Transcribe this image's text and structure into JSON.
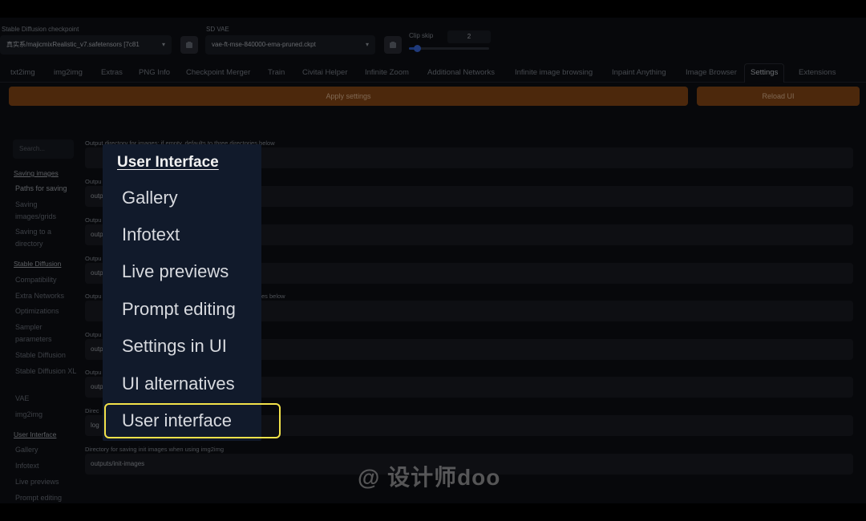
{
  "topbar": {
    "checkpoint_label": "Stable Diffusion checkpoint",
    "checkpoint_value": "真实系/majicmixRealistic_v7.safetensors [7c81",
    "vae_label": "SD VAE",
    "vae_value": "vae-ft-mse-840000-ema-pruned.ckpt",
    "clip_label": "Clip skip",
    "clip_value": "2",
    "clip_skip_level": 0.1
  },
  "tabs": [
    "txt2img",
    "img2img",
    "Extras",
    "PNG Info",
    "Checkpoint Merger",
    "Train",
    "Civitai Helper",
    "Infinite Zoom",
    "Additional Networks",
    "Infinite image browsing",
    "Inpaint Anything",
    "Image Browser",
    "Settings",
    "Extensions"
  ],
  "actions": {
    "apply": "Apply settings",
    "reload": "Reload UI"
  },
  "nav": {
    "search_placeholder": "Search...",
    "items": [
      {
        "label": "Saving images",
        "type": "cat"
      },
      {
        "label": "Paths for saving",
        "type": "sel"
      },
      {
        "label": "Saving images/grids",
        "type": "item"
      },
      {
        "label": "Saving to a directory",
        "type": "item"
      },
      {
        "label": "Stable Diffusion",
        "type": "cat"
      },
      {
        "label": "Compatibility",
        "type": "item"
      },
      {
        "label": "Extra Networks",
        "type": "item"
      },
      {
        "label": "Optimizations",
        "type": "item"
      },
      {
        "label": "Sampler parameters",
        "type": "item"
      },
      {
        "label": "Stable Diffusion",
        "type": "item"
      },
      {
        "label": "Stable Diffusion XL",
        "type": "item"
      },
      {
        "label": "VAE",
        "type": "item"
      },
      {
        "label": "img2img",
        "type": "item"
      },
      {
        "label": "User Interface",
        "type": "cat"
      },
      {
        "label": "Gallery",
        "type": "item"
      },
      {
        "label": "Infotext",
        "type": "item"
      },
      {
        "label": "Live previews",
        "type": "item"
      },
      {
        "label": "Prompt editing",
        "type": "item"
      }
    ]
  },
  "settings_rows": [
    {
      "label": "Output directory for images; if empty, defaults to three directories below",
      "value": ""
    },
    {
      "label": "Outpu",
      "value": "outpu"
    },
    {
      "label": "Outpu",
      "value": "outpu"
    },
    {
      "label": "Outpu",
      "value": "outpu"
    },
    {
      "label": "Outpu",
      "label_right": "es below",
      "value": ""
    },
    {
      "label": "Outpu",
      "value": "outpu"
    },
    {
      "label": "Outpu",
      "value": "outpu"
    },
    {
      "label": "Direc",
      "value": "log"
    },
    {
      "label": "Directory for saving init images when using img2img",
      "value": "outputs/init-images"
    }
  ],
  "popup": {
    "title": "User Interface",
    "items": [
      "Gallery",
      "Infotext",
      "Live previews",
      "Prompt editing",
      "Settings in UI",
      "UI alternatives",
      "User interface"
    ]
  },
  "watermark": "@ 设计师doo"
}
